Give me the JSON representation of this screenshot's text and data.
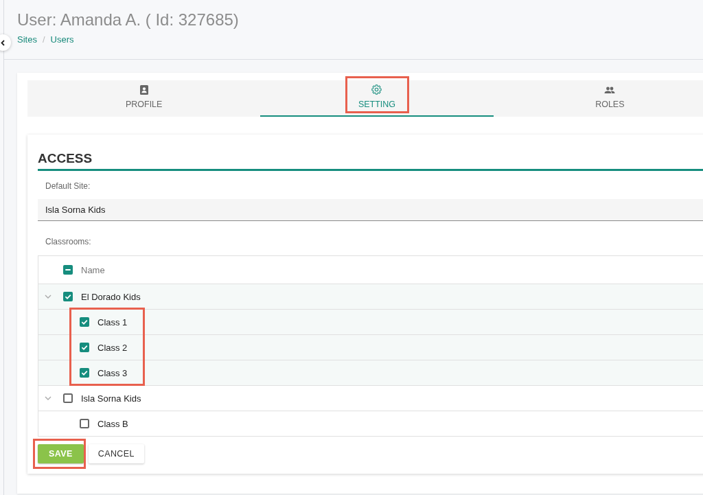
{
  "page": {
    "title": "User: Amanda A. ( Id: 327685)",
    "breadcrumb": {
      "items": [
        "Sites",
        "Users"
      ],
      "separator": "/"
    }
  },
  "tabs": [
    {
      "label": "PROFILE",
      "selected": false,
      "highlighted": false
    },
    {
      "label": "SETTING",
      "selected": true,
      "highlighted": true
    },
    {
      "label": "ROLES",
      "selected": false,
      "highlighted": false
    }
  ],
  "access": {
    "heading": "ACCESS",
    "default_site": {
      "label": "Default Site:",
      "value": "Isla Sorna Kids"
    },
    "classrooms": {
      "label": "Classrooms:",
      "column": "Name",
      "select_all": {
        "indeterminate": true
      },
      "sites": [
        {
          "name": "El Dorado Kids",
          "checked": true,
          "expanded": true,
          "children_highlighted": true,
          "classes": [
            {
              "name": "Class 1",
              "checked": true
            },
            {
              "name": "Class 2",
              "checked": true
            },
            {
              "name": "Class 3",
              "checked": true
            }
          ]
        },
        {
          "name": "Isla Sorna Kids",
          "checked": false,
          "expanded": true,
          "children_highlighted": false,
          "classes": [
            {
              "name": "Class B",
              "checked": false
            }
          ]
        }
      ]
    }
  },
  "buttons": [
    {
      "label": "SAVE",
      "kind": "primary",
      "highlighted": true
    },
    {
      "label": "CANCEL",
      "kind": "secondary",
      "highlighted": false
    }
  ]
}
